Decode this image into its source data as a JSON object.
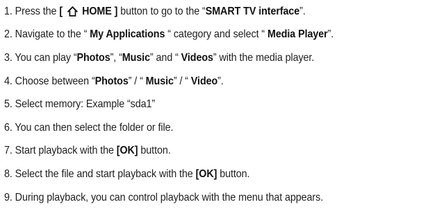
{
  "steps": [
    {
      "id": 1,
      "parts": [
        {
          "t": "1. Press the "
        },
        {
          "t": "[ ",
          "b": true
        },
        {
          "icon": "home-icon"
        },
        {
          "t": " HOME ]",
          "b": true
        },
        {
          "t": " button to go to the “"
        },
        {
          "t": "SMART TV interface",
          "b": true
        },
        {
          "t": "”."
        }
      ]
    },
    {
      "id": 2,
      "parts": [
        {
          "t": "2. Navigate to the “ "
        },
        {
          "t": "My Applications",
          "b": true
        },
        {
          "t": " “ category and select “ "
        },
        {
          "t": "Media Player",
          "b": true
        },
        {
          "t": "”."
        }
      ]
    },
    {
      "id": 3,
      "parts": [
        {
          "t": "3. You can play “"
        },
        {
          "t": "Photos",
          "b": true
        },
        {
          "t": "”, “"
        },
        {
          "t": "Music",
          "b": true
        },
        {
          "t": "” and “ "
        },
        {
          "t": "Videos",
          "b": true
        },
        {
          "t": "” with the media player."
        }
      ]
    },
    {
      "id": 4,
      "parts": [
        {
          "t": "4. Choose between “"
        },
        {
          "t": "Photos",
          "b": true
        },
        {
          "t": "” / “ "
        },
        {
          "t": "Music",
          "b": true
        },
        {
          "t": "” / “ "
        },
        {
          "t": "Video",
          "b": true
        },
        {
          "t": "”."
        }
      ]
    },
    {
      "id": 5,
      "parts": [
        {
          "t": "5. Select memory: Example “sda1”"
        }
      ]
    },
    {
      "id": 6,
      "parts": [
        {
          "t": "6. You can then select the folder or file."
        }
      ]
    },
    {
      "id": 7,
      "parts": [
        {
          "t": "7. Start playback with the "
        },
        {
          "t": "[OK]",
          "b": true
        },
        {
          "t": " button."
        }
      ]
    },
    {
      "id": 8,
      "parts": [
        {
          "t": "8. Select the file and start playback with the "
        },
        {
          "t": "[OK]",
          "b": true
        },
        {
          "t": " button."
        }
      ]
    },
    {
      "id": 9,
      "parts": [
        {
          "t": "9. During playback, you can control playback with the menu that appears."
        }
      ]
    }
  ],
  "colors": {
    "text": "#1e1e1e",
    "background": "#ffffff"
  }
}
